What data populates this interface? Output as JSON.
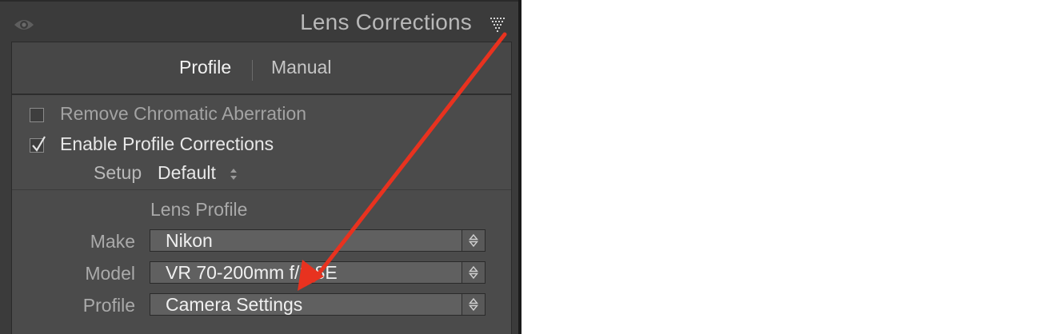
{
  "panel": {
    "title": "Lens Corrections",
    "icons": {
      "visibility": "eye-icon",
      "collapse": "triangle-collapse-icon"
    }
  },
  "tabs": [
    {
      "label": "Profile",
      "active": true
    },
    {
      "label": "Manual",
      "active": false
    }
  ],
  "options": {
    "remove_ca": {
      "label": "Remove Chromatic Aberration",
      "checked": false
    },
    "enable_profile": {
      "label": "Enable Profile Corrections",
      "checked": true
    }
  },
  "setup": {
    "label": "Setup",
    "value": "Default"
  },
  "lens_profile": {
    "heading": "Lens Profile",
    "make": {
      "label": "Make",
      "value": "Nikon"
    },
    "model": {
      "label": "Model",
      "value": "VR 70-200mm f/2.8E"
    },
    "profile": {
      "label": "Profile",
      "value": "Camera Settings"
    }
  },
  "annotation": {
    "arrow_color": "#e8321f"
  }
}
